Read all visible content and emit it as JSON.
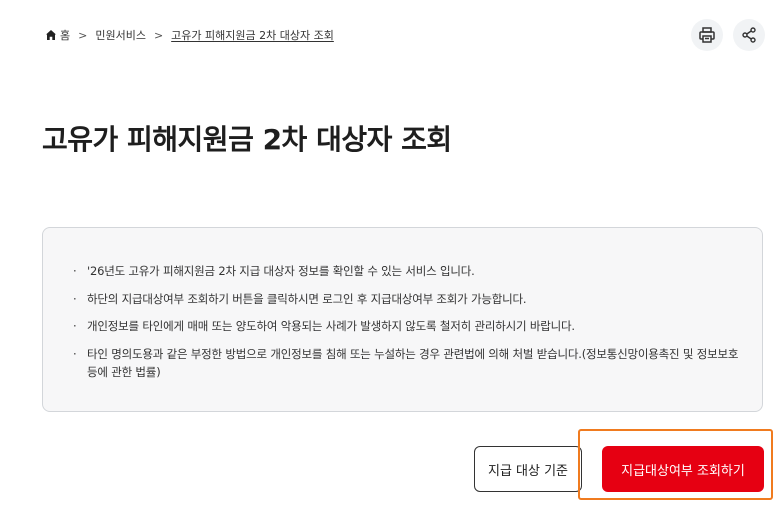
{
  "breadcrumb": {
    "home": "홈",
    "section": "민원서비스",
    "current": "고유가 피해지원금 2차 대상자 조회"
  },
  "header_actions": {
    "print_icon": "print-icon",
    "share_icon": "share-icon"
  },
  "page": {
    "title": "고유가 피해지원금 2차 대상자 조회"
  },
  "notice": {
    "items": [
      "'26년도 고유가 피해지원금 2차 지급 대상자 정보를 확인할 수 있는 서비스 입니다.",
      "하단의 지급대상여부 조회하기 버튼을 클릭하시면 로그인 후 지급대상여부 조회가 가능합니다.",
      "개인정보를 타인에게 매매 또는 양도하여 악용되는 사례가 발생하지 않도록 철저히 관리하시기 바랍니다.",
      "타인 명의도용과 같은 부정한 방법으로 개인정보를 침해 또는 누설하는 경우 관련법에 의해 처벌 받습니다.(정보통신망이용촉진 및 정보보호등에 관한 법률)"
    ]
  },
  "buttons": {
    "criteria": "지급 대상 기준",
    "apply": "지급대상여부 조회하기"
  },
  "colors": {
    "accent_red": "#e60012",
    "highlight_orange": "#f07b1f",
    "box_bg": "#f7f7f8"
  }
}
